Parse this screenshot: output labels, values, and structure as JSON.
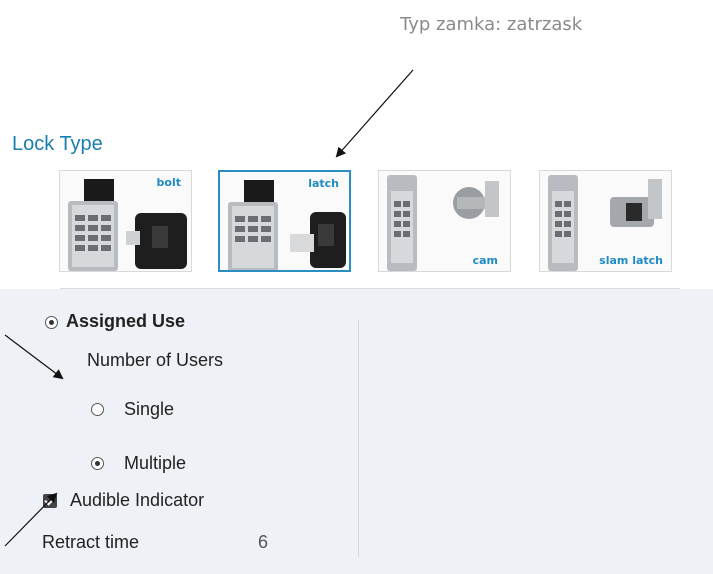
{
  "annotation_label": "Typ zamka: zatrzask",
  "lock_type": {
    "title": "Lock Type",
    "options": [
      {
        "label": "bolt",
        "selected": false
      },
      {
        "label": "latch",
        "selected": true
      },
      {
        "label": "cam",
        "selected": false
      },
      {
        "label": "slam latch",
        "selected": false
      }
    ]
  },
  "assigned_use": {
    "label": "Assigned Use",
    "selected": true,
    "number_of_users": {
      "label": "Number of Users",
      "options": [
        {
          "label": "Single",
          "selected": false
        },
        {
          "label": "Multiple",
          "selected": true
        }
      ]
    }
  },
  "audible_indicator": {
    "label": "Audible Indicator",
    "checked": true
  },
  "retract_time": {
    "label": "Retract time",
    "value": "6"
  },
  "colors": {
    "accent": "#1a7fb0",
    "panel_bg": "#eef2f6",
    "selected_border": "#2a8fc0"
  }
}
